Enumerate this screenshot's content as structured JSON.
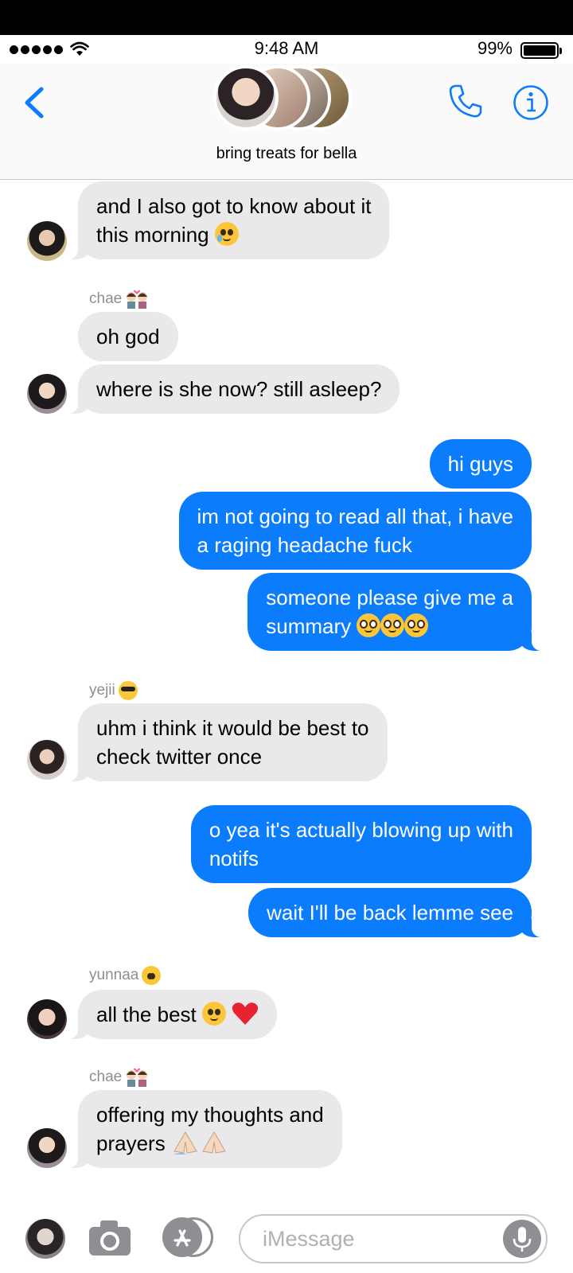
{
  "status_bar": {
    "time": "9:48 AM",
    "battery": "99%"
  },
  "header": {
    "group_name": "bring treats for bella",
    "back_icon": "chevron-left-icon",
    "call_icon": "phone-icon",
    "info_icon": "info-icon"
  },
  "colors": {
    "accent": "#0b7cfb",
    "incoming_bubble": "#e9e9eb",
    "sender_text": "#8e8e93"
  },
  "messages": [
    {
      "direction": "incoming",
      "sender": "",
      "text": "and I also got to know about it",
      "text2": "this morning",
      "emoji": "crying-face"
    },
    {
      "direction": "incoming",
      "sender": "chae",
      "text": "oh god"
    },
    {
      "direction": "incoming",
      "sender": "",
      "text": "where is she now? still asleep?"
    },
    {
      "direction": "outgoing",
      "text": "hi guys"
    },
    {
      "direction": "outgoing",
      "text": "im not going to read all that, i have",
      "text2": "a raging headache fuck"
    },
    {
      "direction": "outgoing",
      "text": "someone please give me a",
      "text2": "summary",
      "emoji": "pleading-face x3"
    },
    {
      "direction": "incoming",
      "sender": "yejii",
      "text": "uhm i think it would be best to",
      "text2": "check twitter once"
    },
    {
      "direction": "outgoing",
      "text": "o yea it's actually blowing up with",
      "text2": "notifs"
    },
    {
      "direction": "outgoing",
      "text": "wait I'll be back lemme see"
    },
    {
      "direction": "incoming",
      "sender": "yunnaa",
      "text": "all the best",
      "emoji": "smiling-face red-heart"
    },
    {
      "direction": "incoming",
      "sender": "chae",
      "text": "offering my thoughts and",
      "text2": "prayers",
      "emoji": "folded-hands x2"
    }
  ],
  "composer": {
    "placeholder": "iMessage",
    "camera_icon": "camera-icon",
    "apps_icon": "app-store-icon",
    "mic_icon": "microphone-icon"
  }
}
